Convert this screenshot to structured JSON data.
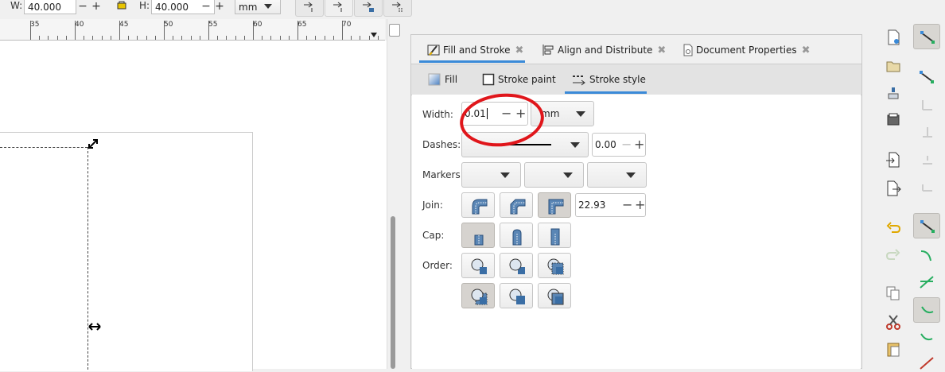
{
  "toolbar": {
    "w_label": "W:",
    "w_value": "40.000",
    "h_label": "H:",
    "h_value": "40.000",
    "unit": "mm",
    "minus": "−",
    "plus": "+"
  },
  "ruler": {
    "labels": [
      "35",
      "40",
      "45",
      "50",
      "55",
      "60",
      "65",
      "70"
    ]
  },
  "dialog": {
    "tabs": [
      {
        "label": "Fill and Stroke",
        "icon": "fill-stroke-icon"
      },
      {
        "label": "Align and Distribute",
        "icon": "align-icon"
      },
      {
        "label": "Document Properties",
        "icon": "document-properties-icon"
      }
    ],
    "close_glyph": "✖",
    "subtabs": [
      {
        "label": "Fill",
        "icon": "fill-icon"
      },
      {
        "label": "Stroke paint",
        "icon": "stroke-paint-icon"
      },
      {
        "label": "Stroke style",
        "icon": "stroke-style-icon"
      }
    ],
    "width": {
      "label": "Width:",
      "value": "0.01",
      "unit": "mm"
    },
    "dashes": {
      "label": "Dashes:",
      "offset": "0.00"
    },
    "markers": {
      "label": "Markers:"
    },
    "join": {
      "label": "Join:",
      "miter": "22.93"
    },
    "cap": {
      "label": "Cap:"
    },
    "order": {
      "label": "Order:"
    }
  },
  "colors": {
    "accent": "#3a8ad8",
    "annotation": "#e0161b"
  }
}
